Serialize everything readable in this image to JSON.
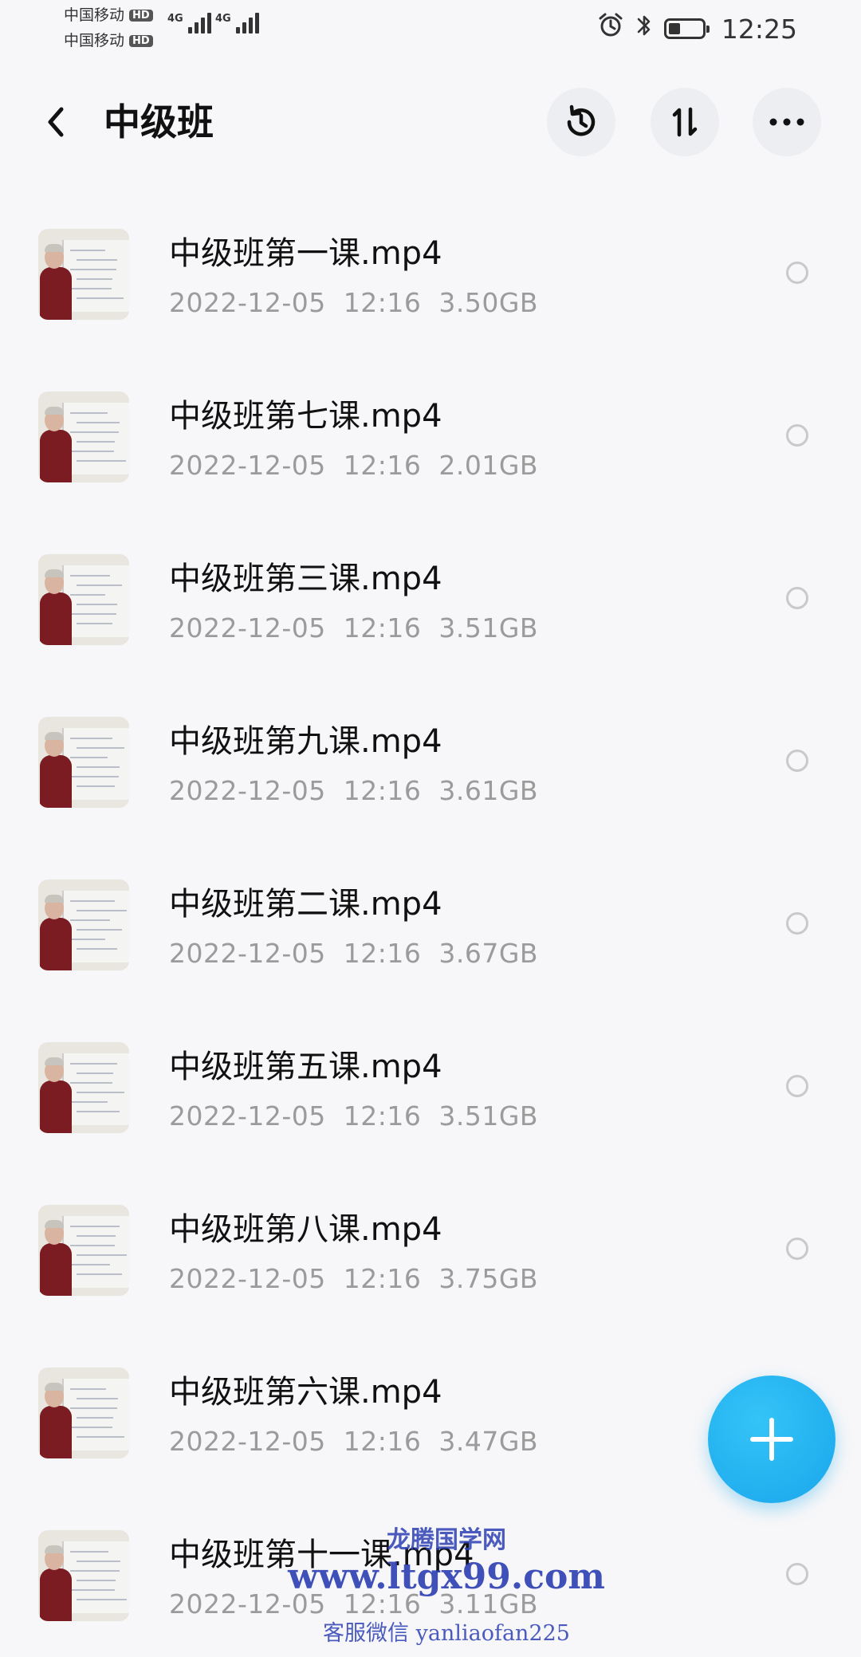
{
  "status_bar": {
    "carrier1": "中国移动",
    "carrier2": "中国移动",
    "hd_badge": "HD",
    "network": "4G",
    "time": "12:25",
    "battery_level": 0.35
  },
  "header": {
    "title": "中级班",
    "back_icon": "chevron-left-icon",
    "history_icon": "history-icon",
    "sort_icon": "sort-icon",
    "more_icon": "more-horizontal-icon"
  },
  "files": [
    {
      "name": "中级班第一课.mp4",
      "date": "2022-12-05",
      "time": "12:16",
      "size": "3.50GB"
    },
    {
      "name": "中级班第七课.mp4",
      "date": "2022-12-05",
      "time": "12:16",
      "size": "2.01GB"
    },
    {
      "name": "中级班第三课.mp4",
      "date": "2022-12-05",
      "time": "12:16",
      "size": "3.51GB"
    },
    {
      "name": "中级班第九课.mp4",
      "date": "2022-12-05",
      "time": "12:16",
      "size": "3.61GB"
    },
    {
      "name": "中级班第二课.mp4",
      "date": "2022-12-05",
      "time": "12:16",
      "size": "3.67GB"
    },
    {
      "name": "中级班第五课.mp4",
      "date": "2022-12-05",
      "time": "12:16",
      "size": "3.51GB"
    },
    {
      "name": "中级班第八课.mp4",
      "date": "2022-12-05",
      "time": "12:16",
      "size": "3.75GB"
    },
    {
      "name": "中级班第六课.mp4",
      "date": "2022-12-05",
      "time": "12:16",
      "size": "3.47GB"
    },
    {
      "name": "中级班第十一课.mp4",
      "date": "2022-12-05",
      "time": "12:16",
      "size": "3.11GB"
    }
  ],
  "fab": {
    "icon": "plus-icon"
  },
  "watermark": {
    "line1": "龙腾国学网",
    "line2": "www.ltgx99.com",
    "line3": "客服微信 yanliaofan225"
  }
}
